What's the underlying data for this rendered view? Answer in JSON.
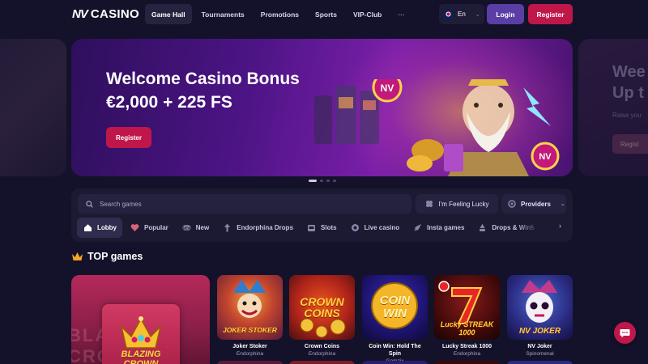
{
  "brand": {
    "mark": "NV",
    "name": "CASINO"
  },
  "nav": [
    {
      "label": "Game Hall",
      "active": true
    },
    {
      "label": "Tournaments",
      "active": false
    },
    {
      "label": "Promotions",
      "active": false
    },
    {
      "label": "Sports",
      "active": false
    },
    {
      "label": "VIP-Club",
      "active": false
    },
    {
      "label": "···",
      "active": false
    }
  ],
  "header": {
    "language": "En",
    "login_label": "Login",
    "register_label": "Register"
  },
  "hero": {
    "title": "Welcome Casino Bonus",
    "subtitle": "€2,000 + 225 FS",
    "button": "Register",
    "slides": 4,
    "active_slide": 1,
    "next_slide_title": "Wee Up t",
    "next_slide_sub": "Raise you",
    "next_slide_button": "Regist"
  },
  "search": {
    "placeholder": "Search games",
    "lucky_label": "I'm Feeling Lucky",
    "providers_label": "Providers"
  },
  "categories": [
    {
      "label": "Lobby",
      "icon": "home-icon",
      "active": true
    },
    {
      "label": "Popular",
      "icon": "heart-icon",
      "active": false
    },
    {
      "label": "New",
      "icon": "new-badge-icon",
      "active": false
    },
    {
      "label": "Endorphina Drops",
      "icon": "drops-icon",
      "active": false
    },
    {
      "label": "Slots",
      "icon": "slot-machine-icon",
      "active": false
    },
    {
      "label": "Live casino",
      "icon": "live-icon",
      "active": false
    },
    {
      "label": "Insta games",
      "icon": "rocket-icon",
      "active": false
    },
    {
      "label": "Drops & Wins",
      "icon": "coins-icon",
      "active": false
    }
  ],
  "top_games": {
    "title": "TOP games",
    "featured": {
      "name": "BLAZING CROWN",
      "bg_text": "BLAZING CROWN"
    },
    "games": [
      {
        "title": "Joker Stoker",
        "provider": "Endorphina",
        "art_text": "JOKER STOKER"
      },
      {
        "title": "Crown Coins",
        "provider": "Endorphina",
        "art_text": "CROWN COINS"
      },
      {
        "title": "Coin Win: Hold The Spin",
        "provider": "Gamzix",
        "art_text": "COIN WIN"
      },
      {
        "title": "Lucky Streak 1000",
        "provider": "Endorphina",
        "art_text": "Lucky STREAK 1000"
      },
      {
        "title": "NV Joker",
        "provider": "Spinomenal",
        "art_text": "NV JOKER"
      }
    ]
  },
  "colors": {
    "accent": "#c0174a",
    "login": "#5a3ea6",
    "background": "#14122a",
    "panel": "#1c1a33"
  }
}
